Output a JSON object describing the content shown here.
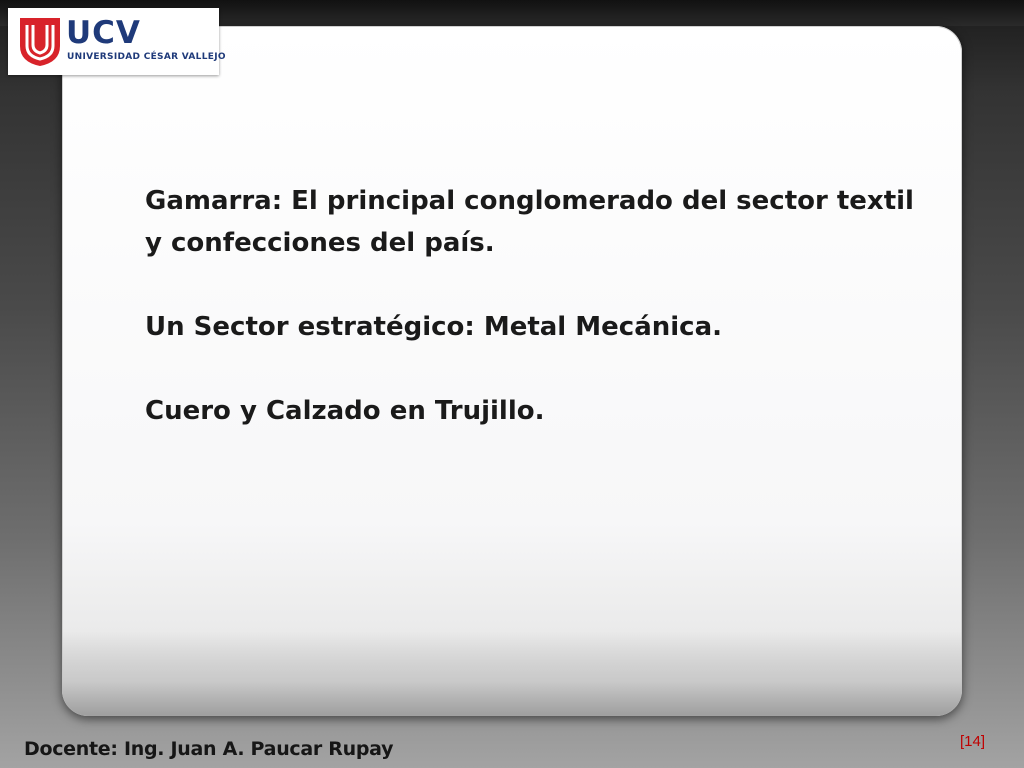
{
  "logo": {
    "name": "UCV",
    "subtitle": "UNIVERSIDAD CÉSAR VALLEJO",
    "color_brand_red": "#d8232a",
    "color_brand_blue": "#1f3a7a"
  },
  "slide": {
    "paragraphs": [
      "Gamarra: El principal conglomerado del sector textil y confecciones del país.",
      "Un Sector estratégico: Metal Mecánica.",
      "Cuero y Calzado en Trujillo."
    ]
  },
  "footer": {
    "teacher": "Docente: Ing. Juan A. Paucar Rupay",
    "page_number": "[14]"
  }
}
